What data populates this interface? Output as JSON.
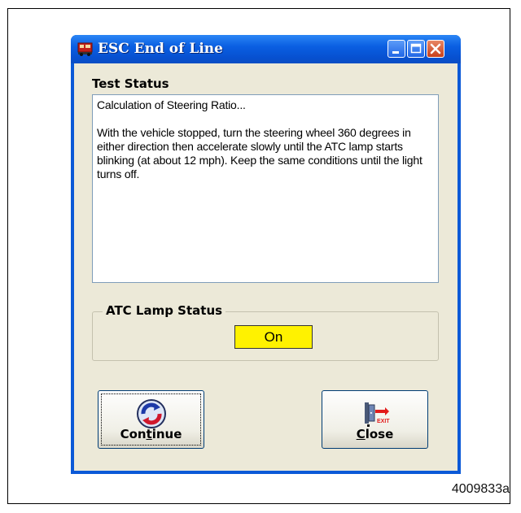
{
  "window": {
    "title": "ESC End of Line",
    "icon": "app-icon",
    "controls": {
      "minimize": "minimize-icon",
      "maximize": "maximize-icon",
      "close": "close-icon"
    }
  },
  "test_status": {
    "label": "Test Status",
    "line1": "Calculation of Steering Ratio...",
    "line2": "With the vehicle stopped, turn the steering wheel 360 degrees in either direction then accelerate slowly until the ATC lamp starts blinking (at about 12 mph).  Keep the same conditions until the light turns off."
  },
  "atc_lamp": {
    "label": "ATC Lamp Status",
    "value": "On",
    "color": "#fff200"
  },
  "buttons": {
    "continue_label": "Continue",
    "continue_icon": "refresh-icon",
    "close_label": "Close",
    "close_icon": "exit-icon"
  },
  "figure_id": "4009833a"
}
